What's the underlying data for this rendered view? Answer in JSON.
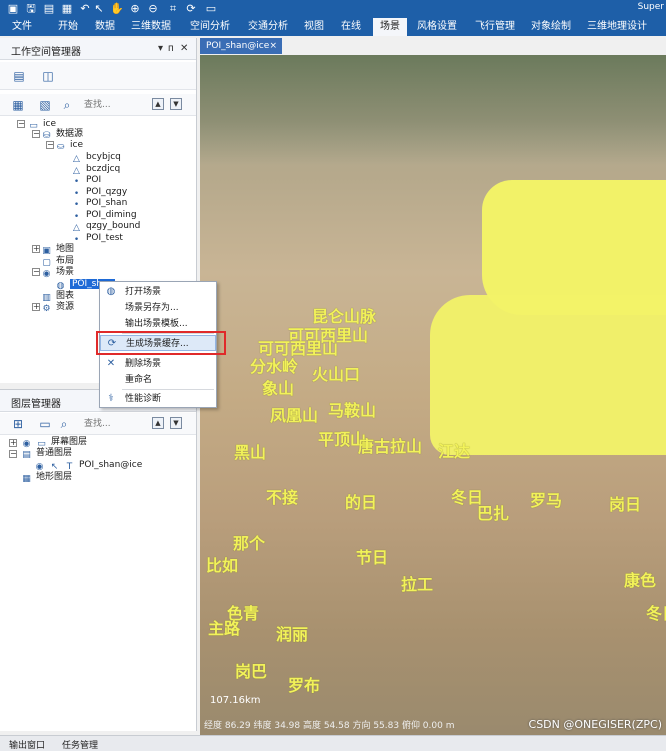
{
  "title_bar": {
    "app_title": "Super"
  },
  "menubar": {
    "items": [
      "文件",
      "开始",
      "数据",
      "三维数据",
      "空间分析",
      "交通分析",
      "视图",
      "在线",
      "场景",
      "风格设置",
      "飞行管理",
      "对象绘制",
      "三维地理设计"
    ],
    "active": "场景"
  },
  "workspace_panel": {
    "title": "工作空间管理器",
    "pin_icon": "pin-icon",
    "close_icon": "close-icon",
    "search_placeholder": "查找...",
    "tree": {
      "root": "ice",
      "datasource_group": "数据源",
      "datasource": "ice",
      "datasets": [
        "bcybjcq",
        "bczdjcq",
        "POI",
        "POI_qzgy",
        "POI_shan",
        "POI_diming",
        "qzgy_bound",
        "POI_test"
      ],
      "maps": "地图",
      "layouts": "布局",
      "scenes": "场景",
      "scene_item": "POI_shan",
      "charts": "图表",
      "resources": "资源"
    }
  },
  "context_menu": {
    "items": [
      "打开场景",
      "场景另存为...",
      "输出场景模板...",
      "生成场景缓存...",
      "删除场景",
      "重命名",
      "性能诊断"
    ],
    "highlighted": "生成场景缓存..."
  },
  "layer_panel": {
    "title": "图层管理器",
    "search_placeholder": "查找...",
    "tree": {
      "screen_layers": "屏幕图层",
      "normal_layers": "普通图层",
      "layer_item": "POI_shan@ice",
      "terrain_layers": "地形图层"
    }
  },
  "document_tab": {
    "label": "POI_shan@ice",
    "close": "×"
  },
  "scene_view": {
    "labels": [
      "昆仑山脉",
      "可可西里山",
      "可可西里山",
      "分水岭",
      "象山",
      "火山口",
      "凤凰山",
      "马鞍山",
      "平顶山",
      "唐古拉山",
      "江达",
      "黑山",
      "不接",
      "的日",
      "冬日",
      "巴扎",
      "罗马",
      "那个",
      "节日",
      "比如",
      "拉工",
      "色青",
      "主路",
      "润丽",
      "岗巴",
      "罗布",
      "康色",
      "冬日",
      "岗日"
    ],
    "scale_text": "107.16km",
    "status_text": "经度 86.29   纬度 34.98   高度 54.58   方向 55.83   俯仰 0.00   m",
    "watermark": "CSDN @ONEGISER(ZPC)"
  },
  "bottom_tabs": [
    "输出窗口",
    "任务管理"
  ],
  "colors": {
    "accent": "#1e5fa8",
    "label_yellow": "#f2f25a",
    "highlight_red": "#e02a2a",
    "selection_blue": "#1e6ad6"
  }
}
